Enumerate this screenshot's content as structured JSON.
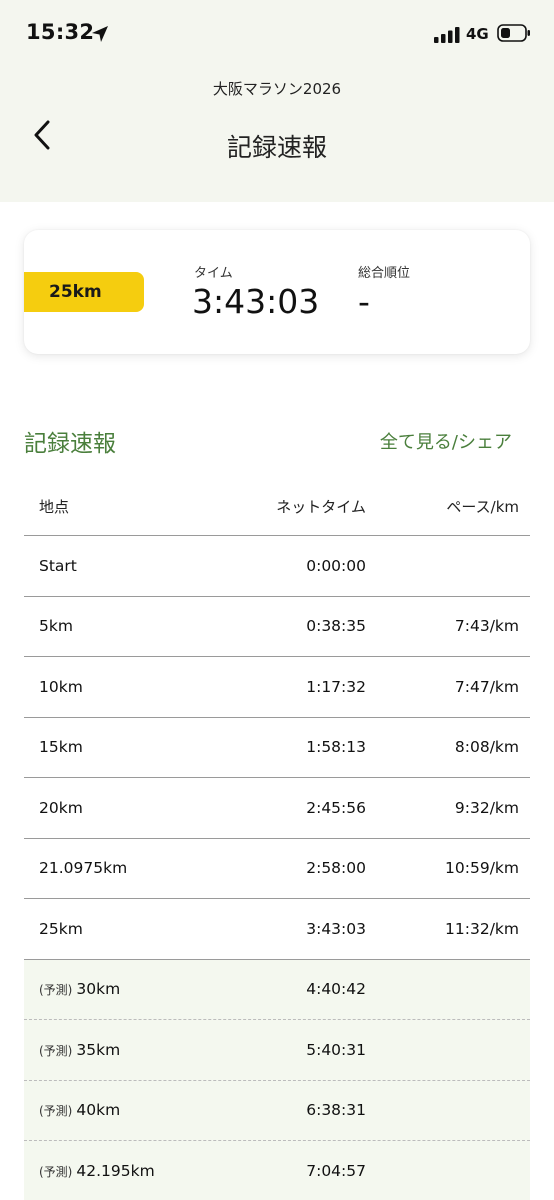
{
  "status": {
    "time": "15:32",
    "network": "4G"
  },
  "header": {
    "event": "大阪マラソン2026",
    "title": "記録速報"
  },
  "summary": {
    "distance": "25km",
    "time_label": "タイム",
    "time_value": "3:43:03",
    "rank_label": "総合順位",
    "rank_value": "-"
  },
  "section": {
    "title": "記録速報",
    "see_all": "全て見る/シェア"
  },
  "table": {
    "headers": {
      "point": "地点",
      "net_time": "ネットタイム",
      "pace": "ペース/km"
    },
    "rows": [
      {
        "point": "Start",
        "time": "0:00:00",
        "pace": ""
      },
      {
        "point": "5km",
        "time": "0:38:35",
        "pace": "7:43/km"
      },
      {
        "point": "10km",
        "time": "1:17:32",
        "pace": "7:47/km"
      },
      {
        "point": "15km",
        "time": "1:58:13",
        "pace": "8:08/km"
      },
      {
        "point": "20km",
        "time": "2:45:56",
        "pace": "9:32/km"
      },
      {
        "point": "21.0975km",
        "time": "2:58:00",
        "pace": "10:59/km"
      },
      {
        "point": "25km",
        "time": "3:43:03",
        "pace": "11:32/km"
      }
    ],
    "predicted_tag": "(予測)",
    "predicted": [
      {
        "point": "30km",
        "time": "4:40:42"
      },
      {
        "point": "35km",
        "time": "5:40:31"
      },
      {
        "point": "40km",
        "time": "6:38:31"
      },
      {
        "point": "42.195km",
        "time": "7:04:57"
      }
    ]
  },
  "icons": {
    "location": "location-arrow-icon",
    "signal": "signal-bars-icon",
    "battery": "battery-icon",
    "back": "chevron-left-icon"
  },
  "colors": {
    "accent_green": "#4a7f3c",
    "badge_yellow": "#f5cd0f",
    "header_bg": "#f4f6ef"
  }
}
